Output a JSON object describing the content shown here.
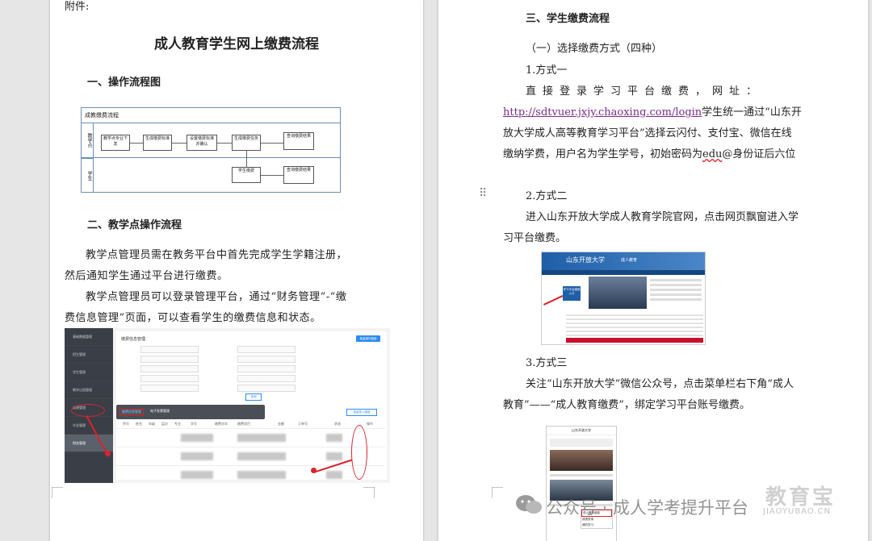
{
  "left_page": {
    "attachment": "附件:",
    "title": "成人教育学生网上缴费流程",
    "section1": "一、操作流程图",
    "flowchart": {
      "title": "成教缴费流程",
      "lane1": "教学点",
      "lane2": "学生",
      "boxes": [
        "教学点专业下发",
        "生成缴费标准",
        "设置缴费标准并确认",
        "生成缴费任务",
        "查询缴费结果",
        "学生缴费",
        "查询缴费结果"
      ]
    },
    "section2": "二、教学点操作流程",
    "para1": "教学点管理员需在教务平台中首先完成学生学籍注册，然后通知学生通过平台进行缴费。",
    "para2": "教学点管理员可以登录管理平台，通过“财务管理”-“缴费信息管理”页面，可以查看学生的缴费信息和状态。",
    "admin": {
      "menu": [
        "基础数据管理",
        "招生管理",
        "学生管理",
        "教学过程管理",
        "成绩管理",
        "毕业管理",
        "财务管理"
      ],
      "panel_title": "缴费信息管理",
      "top_button": "批量操作缴费",
      "bottom_button": "查询",
      "tooltip": "缴费信息管理",
      "tab": "电子发票管理",
      "right_button": "批量导入缴费",
      "columns": [
        "序号",
        "姓名",
        "年级",
        "层次",
        "专业",
        "学号",
        "缴费学年",
        "缴费项目",
        "金额",
        "订单号",
        "状态",
        "操作"
      ]
    }
  },
  "right_page": {
    "section3": "三、学生缴费流程",
    "sub1": "（一）选择缴费方式（四种）",
    "way1_title": "1.方式一",
    "way1_text_a": "直接登录学习平台缴费，网址：",
    "url": "http://sdtvuer.jxjy.chaoxing.com/login",
    "way1_text_b": "学生统一通过“山东开放大学成人高等教育学习平台”选择云闪付、支付宝、微信在线缴纳学费，用户名为学生学号，初始密码为",
    "pwd_word": "edu",
    "way1_text_c": "@身份证后六位",
    "way2_title": "2.方式二",
    "way2_text": "进入山东开放大学成人教育学院官网，点击网页飘窗进入学习平台缴费。",
    "site": {
      "logo": "山东开放大学",
      "logo_sub": "成人教育",
      "float_label": "学习平台缴费入口"
    },
    "way3_title": "3.方式三",
    "way3_text": "关注“山东开放大学”微信公众号，点击菜单栏右下角“成人教育”——“成人教育缴费”，绑定学习平台账号缴费。",
    "wechat": {
      "title": "山东开放大学",
      "menu": [
        "成人教育缴费",
        "成绩查询",
        "我的学习"
      ]
    }
  },
  "watermark": {
    "text": "公众号 · 成人学考提升平台",
    "brand": "教育宝",
    "brand_sub": "JIAOYUBAO.CN"
  }
}
